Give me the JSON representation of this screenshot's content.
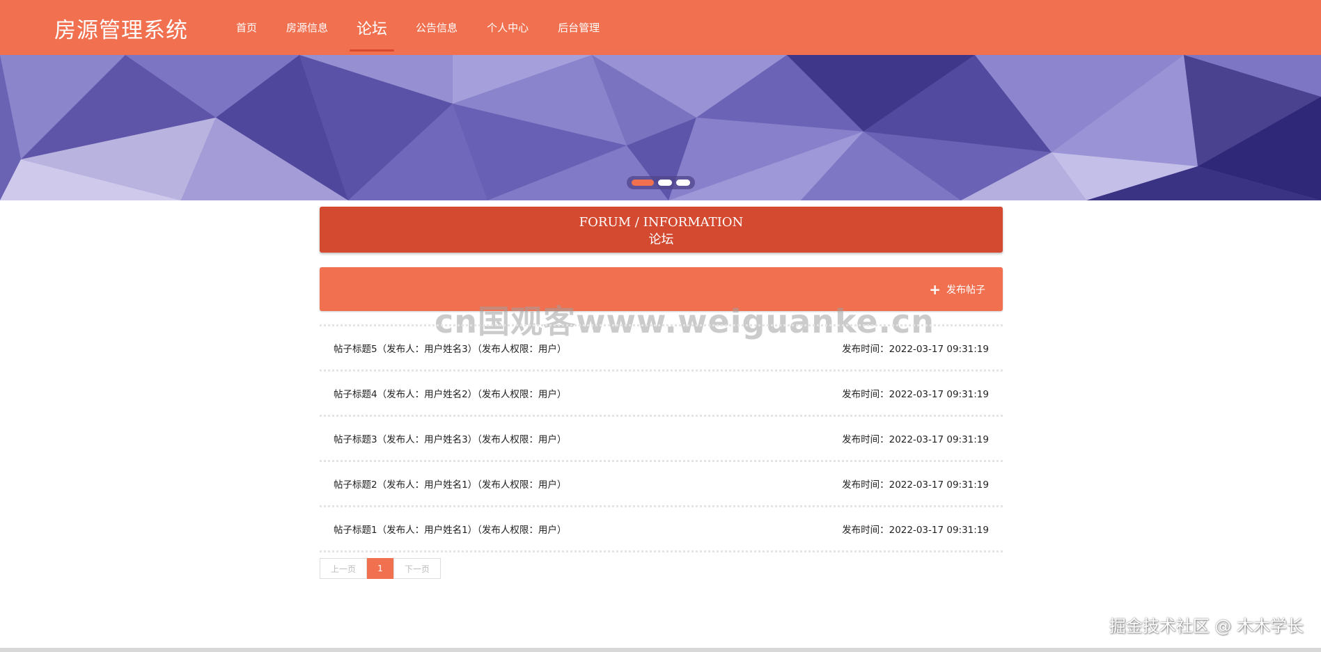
{
  "header": {
    "logo": "房源管理系统",
    "nav": [
      {
        "label": "首页"
      },
      {
        "label": "房源信息"
      },
      {
        "label": "论坛",
        "active": true
      },
      {
        "label": "公告信息"
      },
      {
        "label": "个人中心"
      },
      {
        "label": "后台管理"
      }
    ]
  },
  "banner": {
    "slides": 3,
    "active_slide": 1
  },
  "title": {
    "en": "FORUM / INFORMATION",
    "cn": "论坛"
  },
  "actions": {
    "publish_label": "发布帖子",
    "publish_icon": "plus-icon"
  },
  "watermark": "cn国观客www.weiguanke.cn",
  "posts": [
    {
      "title": "帖子标题5（发布人：用户姓名3）（发布人权限：用户）",
      "time": "发布时间：2022-03-17 09:31:19"
    },
    {
      "title": "帖子标题4（发布人：用户姓名2）（发布人权限：用户）",
      "time": "发布时间：2022-03-17 09:31:19"
    },
    {
      "title": "帖子标题3（发布人：用户姓名3）（发布人权限：用户）",
      "time": "发布时间：2022-03-17 09:31:19"
    },
    {
      "title": "帖子标题2（发布人：用户姓名1）（发布人权限：用户）",
      "time": "发布时间：2022-03-17 09:31:19"
    },
    {
      "title": "帖子标题1（发布人：用户姓名1）（发布人权限：用户）",
      "time": "发布时间：2022-03-17 09:31:19"
    }
  ],
  "pagination": {
    "prev": "上一页",
    "current": "1",
    "next": "下一页"
  },
  "footer_mark": "掘金技术社区 @ 木木学长",
  "colors": {
    "primary": "#f07050",
    "title_bar": "#d34a30",
    "banner": "#7a72c0"
  }
}
